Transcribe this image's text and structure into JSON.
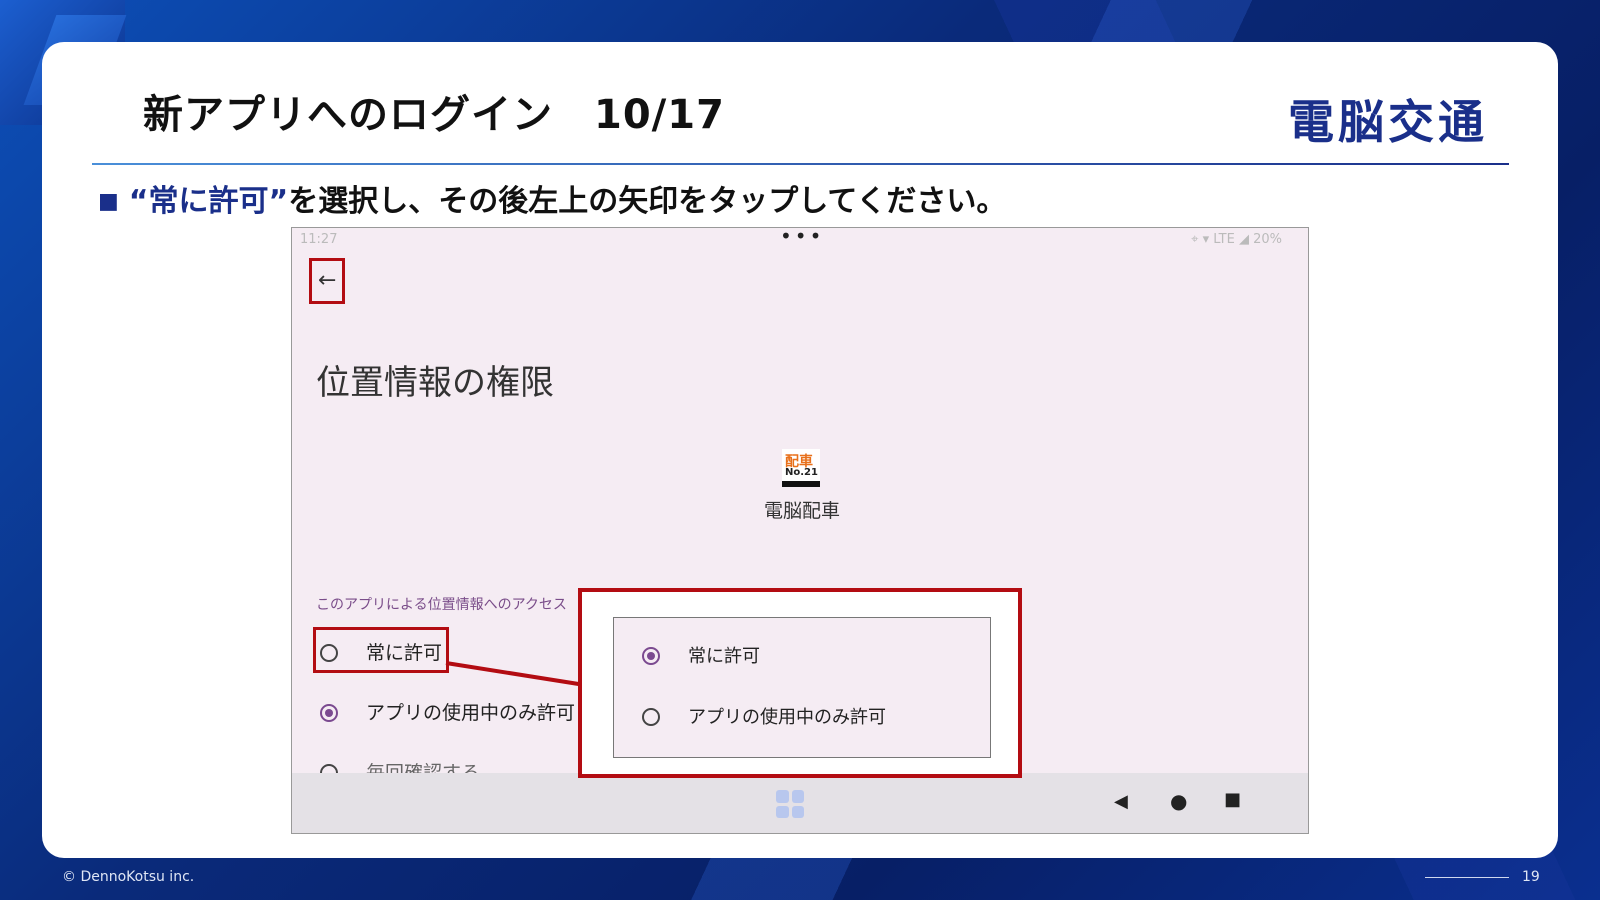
{
  "slide": {
    "title": "新アプリへのログイン　10/17",
    "brand": "電脳交通",
    "instruction_highlight": "“常に許可”",
    "instruction_rest": "を選択し、その後左上の矢印をタップしてください。",
    "footer_copyright": "© DennoKotsu inc.",
    "page_number": "19"
  },
  "phone": {
    "status_time": "11:27",
    "status_dots": "•••",
    "status_right": "⌖ ▾ LTE ◢ 20%",
    "back_icon": "←",
    "page_title": "位置情報の権限",
    "app_icon_top": "配車",
    "app_icon_bottom": "No.21",
    "app_name": "電脳配車",
    "access_label": "このアプリによる位置情報へのアクセス",
    "options": [
      {
        "label": "常に許可",
        "selected": false
      },
      {
        "label": "アプリの使用中のみ許可",
        "selected": true
      },
      {
        "label": "毎回確認する",
        "selected": false
      }
    ],
    "nav": {
      "back": "◀",
      "home": "●",
      "recent": "■"
    }
  },
  "zoom": {
    "options": [
      {
        "label": "常に許可",
        "selected": true
      },
      {
        "label": "アプリの使用中のみ許可",
        "selected": false
      }
    ]
  },
  "colors": {
    "highlight_red": "#b30c12",
    "brand_blue": "#1a2f8a",
    "radio_purple": "#7b4a90"
  }
}
